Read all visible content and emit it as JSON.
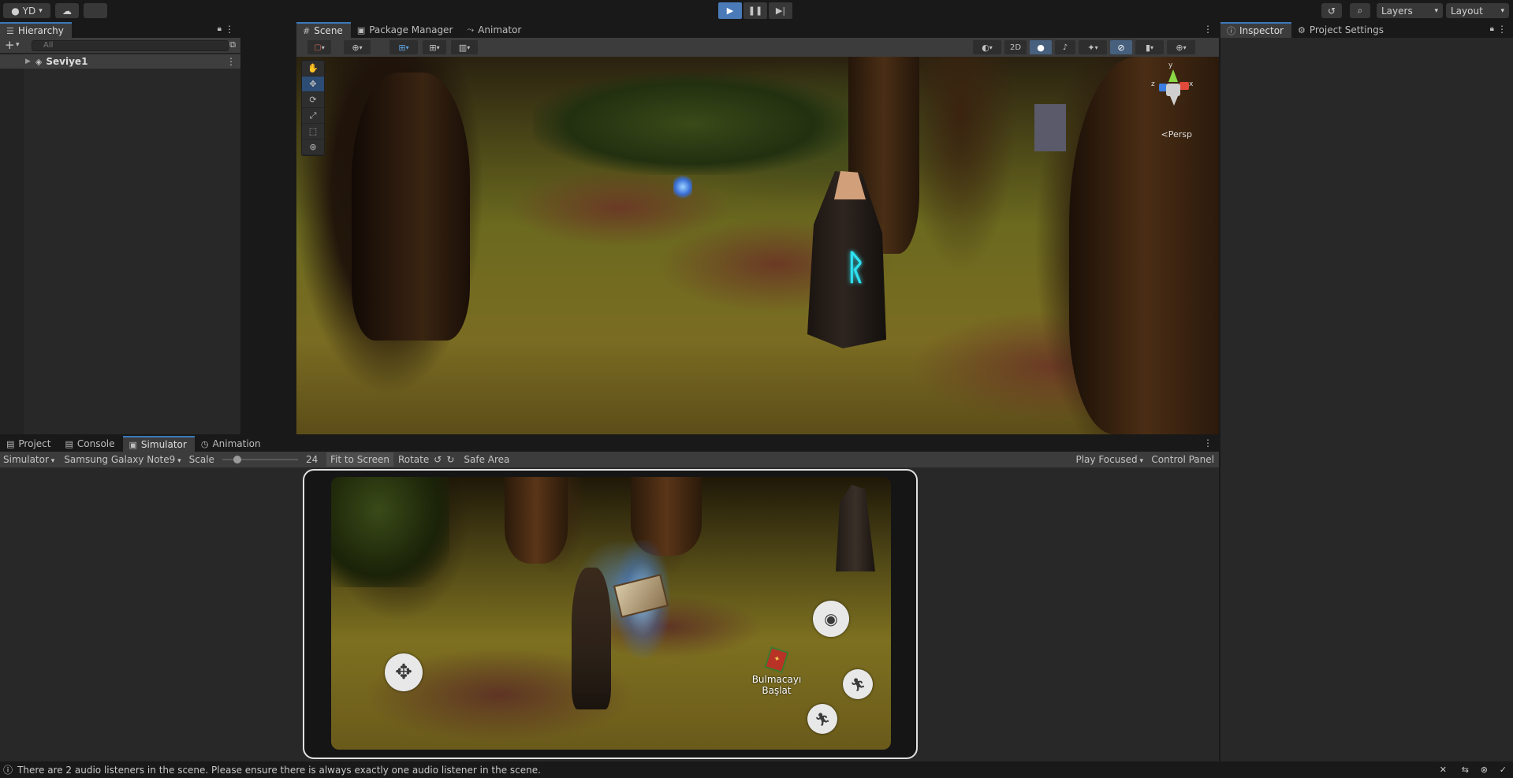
{
  "toolbar": {
    "account_label": "YD",
    "layers_label": "Layers",
    "layout_label": "Layout"
  },
  "hierarchy": {
    "tab_label": "Hierarchy",
    "search_placeholder": "All",
    "root_item": "Seviye1"
  },
  "scene_panel": {
    "tabs": [
      {
        "label": "Scene"
      },
      {
        "label": "Package Manager"
      },
      {
        "label": "Animator"
      }
    ],
    "toggle_2d": "2D",
    "gizmo_axes": {
      "x": "x",
      "y": "y",
      "z": "z"
    },
    "persp_label": "Persp"
  },
  "inspector_panel": {
    "tabs": [
      {
        "label": "Inspector"
      },
      {
        "label": "Project Settings"
      }
    ]
  },
  "bottom_panel": {
    "tabs": [
      {
        "label": "Project"
      },
      {
        "label": "Console"
      },
      {
        "label": "Simulator"
      },
      {
        "label": "Animation"
      }
    ],
    "simulator_toolbar": {
      "mode": "Simulator",
      "device": "Samsung Galaxy Note9",
      "scale_label": "Scale",
      "scale_value": "24",
      "fit_to_screen": "Fit to Screen",
      "rotate": "Rotate",
      "safe_area": "Safe Area",
      "play_focused": "Play Focused",
      "control_panel": "Control Panel"
    },
    "game_ui": {
      "puzzle_label_line1": "Bulmacayı",
      "puzzle_label_line2": "Başlat"
    }
  },
  "status": {
    "message": "There are 2 audio listeners in the scene. Please ensure there is always exactly one audio listener in the scene."
  },
  "colors": {
    "accent": "#3a79bb",
    "play_active": "#4a7ab8",
    "panel_bg": "#282828",
    "toolbar_bg": "#191919"
  }
}
